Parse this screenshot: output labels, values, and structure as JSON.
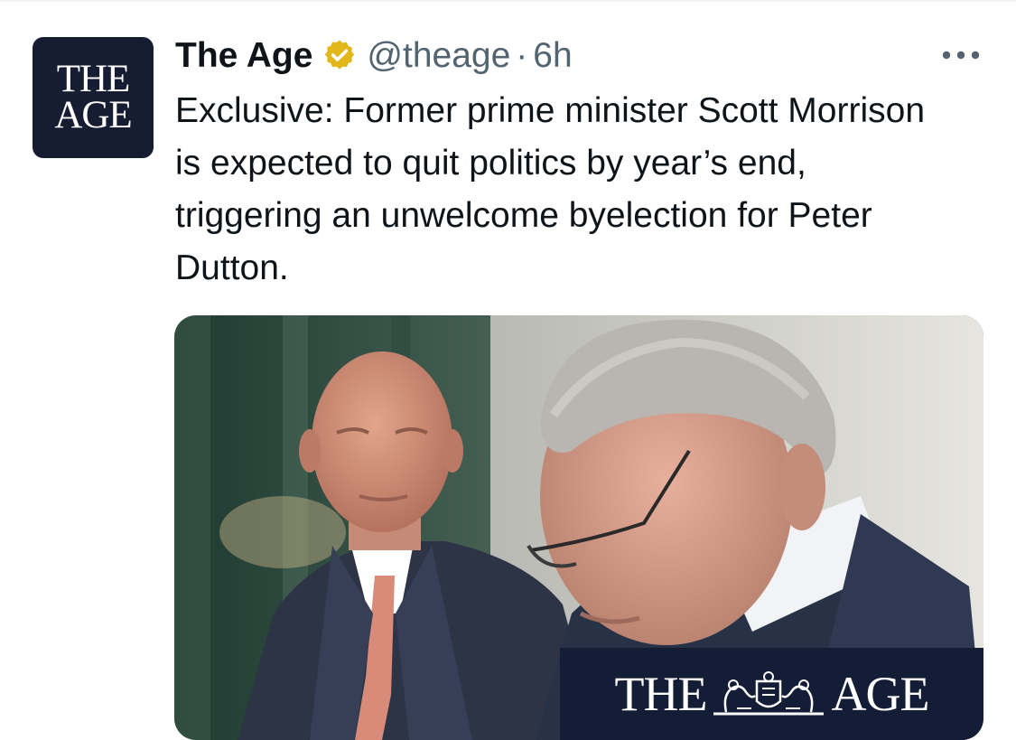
{
  "tweet": {
    "avatar": {
      "line1": "THE",
      "line2": "AGE"
    },
    "author": {
      "display_name": "The Age",
      "verified_icon": "verified-badge-icon",
      "handle": "@theage",
      "separator": "·",
      "time": "6h"
    },
    "more_icon": "more-dots-icon",
    "text": "Exclusive: Former prime minister Scott Morrison is expected to quit politics by year’s end, triggering an unwelcome byelection for Peter Dutton.",
    "media": {
      "watermark": {
        "left_text": "THE",
        "right_text": "AGE",
        "crest_icon": "coat-of-arms-icon"
      }
    }
  },
  "colors": {
    "text": "#0f1419",
    "secondary": "#536471",
    "brand_navy": "#161d33",
    "verified_gold": "#e2b719"
  }
}
